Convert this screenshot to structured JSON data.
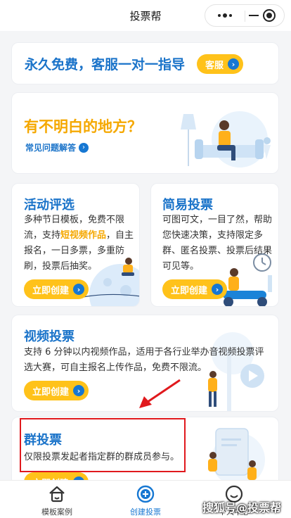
{
  "nav": {
    "title": "投票帮"
  },
  "banner": {
    "text": "永久免费，客服一对一指导",
    "button_label": "客服"
  },
  "help": {
    "title": "有不明白的地方？",
    "link_label": "常见问题解答"
  },
  "activity": {
    "title": "活动评选",
    "desc_before": "多种节日模板，免费不限流，支持",
    "desc_highlight": "短视频作品",
    "desc_after": "，自主报名，一日多票，多重防刷，投票后抽奖。",
    "button_label": "立即创建"
  },
  "simple": {
    "title": "简易投票",
    "desc": "可图可文，一目了然，帮助您快速决策，支持限定多群、匿名投票、投票后结果可见等。",
    "button_label": "立即创建"
  },
  "video": {
    "title": "视频投票",
    "desc": "支持 6 分钟以内视频作品，适用于各行业举办音视频投票评选大赛，可自主报名上传作品，免费不限流。",
    "button_label": "立即创建"
  },
  "group": {
    "title": "群投票",
    "desc": "仅限投票发起者指定群的群成员参与。",
    "button_label": "立即创建"
  },
  "tabbar": {
    "tabs": [
      {
        "label": "模板案例"
      },
      {
        "label": "创建投票"
      },
      {
        "label": "个人中心"
      }
    ]
  },
  "watermark": {
    "text": "搜狐号@投票帮"
  },
  "colors": {
    "brand_blue": "#1677d2",
    "accent_yellow": "#ffc21a",
    "annotation_red": "#e0191d"
  }
}
